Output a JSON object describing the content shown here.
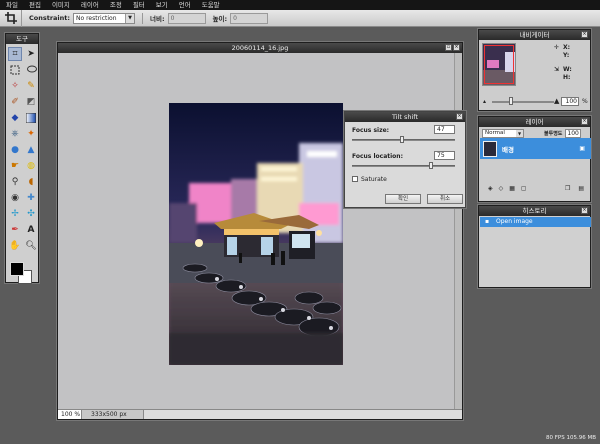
{
  "menu": [
    "파일",
    "편집",
    "이미지",
    "레이어",
    "조정",
    "필터",
    "보기",
    "언어",
    "도움말"
  ],
  "options": {
    "constraint_label": "Constraint:",
    "constraint_value": "No restriction",
    "width_label": "너비:",
    "width_value": "0",
    "height_label": "높이:",
    "height_value": "0"
  },
  "tools_panel": {
    "title": "도구"
  },
  "document": {
    "title": "20060114_16.jpg",
    "zoom": "100 %",
    "dimensions": "333x500 px"
  },
  "tilt_shift": {
    "title": "Tilt shift",
    "focus_size_label": "Focus size:",
    "focus_size_value": "47",
    "focus_location_label": "Focus location:",
    "focus_location_value": "75",
    "saturate_label": "Saturate",
    "ok_label": "확인",
    "cancel_label": "취소"
  },
  "navigator": {
    "title": "내비게이터",
    "x_label": "X:",
    "y_label": "Y:",
    "w_label": "W:",
    "h_label": "H:",
    "zoom_value": "100",
    "zoom_unit": "%"
  },
  "layers": {
    "title": "레이어",
    "blend_mode": "Normal",
    "opacity_label": "불투명도",
    "opacity_value": "100",
    "layer_name": "배경"
  },
  "history": {
    "title": "히스토리",
    "item": "Open image"
  },
  "status": {
    "fps": "80 FPS 105.96 MB"
  }
}
